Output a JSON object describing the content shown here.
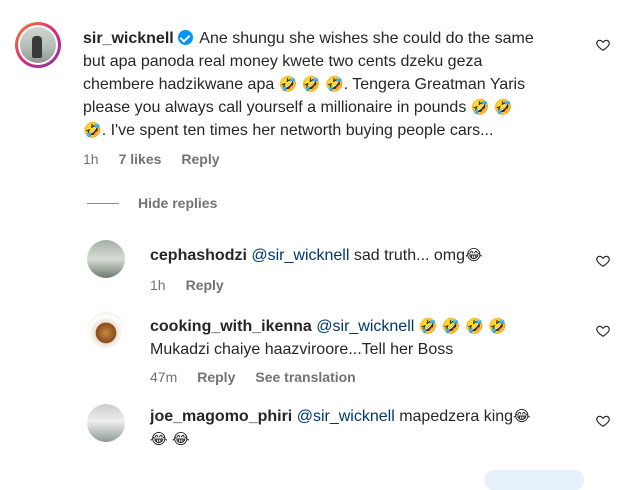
{
  "main_comment": {
    "username": "sir_wicknell",
    "lines": [
      "Ane shungu she wishes she could do the same",
      "but apa panoda real money kwete two cents dzeku geza",
      "chembere hadzikwane apa",
      ". Tengera Greatman Yaris",
      "please you always call yourself a millionaire in pounds",
      ". I've spent ten times her networth buying people cars..."
    ],
    "time": "1h",
    "likes": "7 likes",
    "reply": "Reply"
  },
  "hide_replies": "Hide replies",
  "replies": [
    {
      "username": "cephashodzi",
      "mention": "@sir_wicknell",
      "text": "sad truth... omg",
      "time": "1h",
      "reply": "Reply"
    },
    {
      "username": "cooking_with_ikenna",
      "mention": "@sir_wicknell",
      "line2": "Mukadzi chaiye haazviroore...Tell her Boss",
      "time": "47m",
      "reply": "Reply",
      "translation": "See translation"
    },
    {
      "username": "joe_magomo_phiri",
      "mention": "@sir_wicknell",
      "text": "mapedzera king"
    }
  ],
  "emojis": {
    "rofl": "🤣",
    "joy": "😂"
  },
  "colors": {
    "verified": "#0095f6",
    "mention": "#00376b",
    "meta": "#737373"
  },
  "icons": [
    "heart-icon",
    "verified-badge-icon"
  ]
}
